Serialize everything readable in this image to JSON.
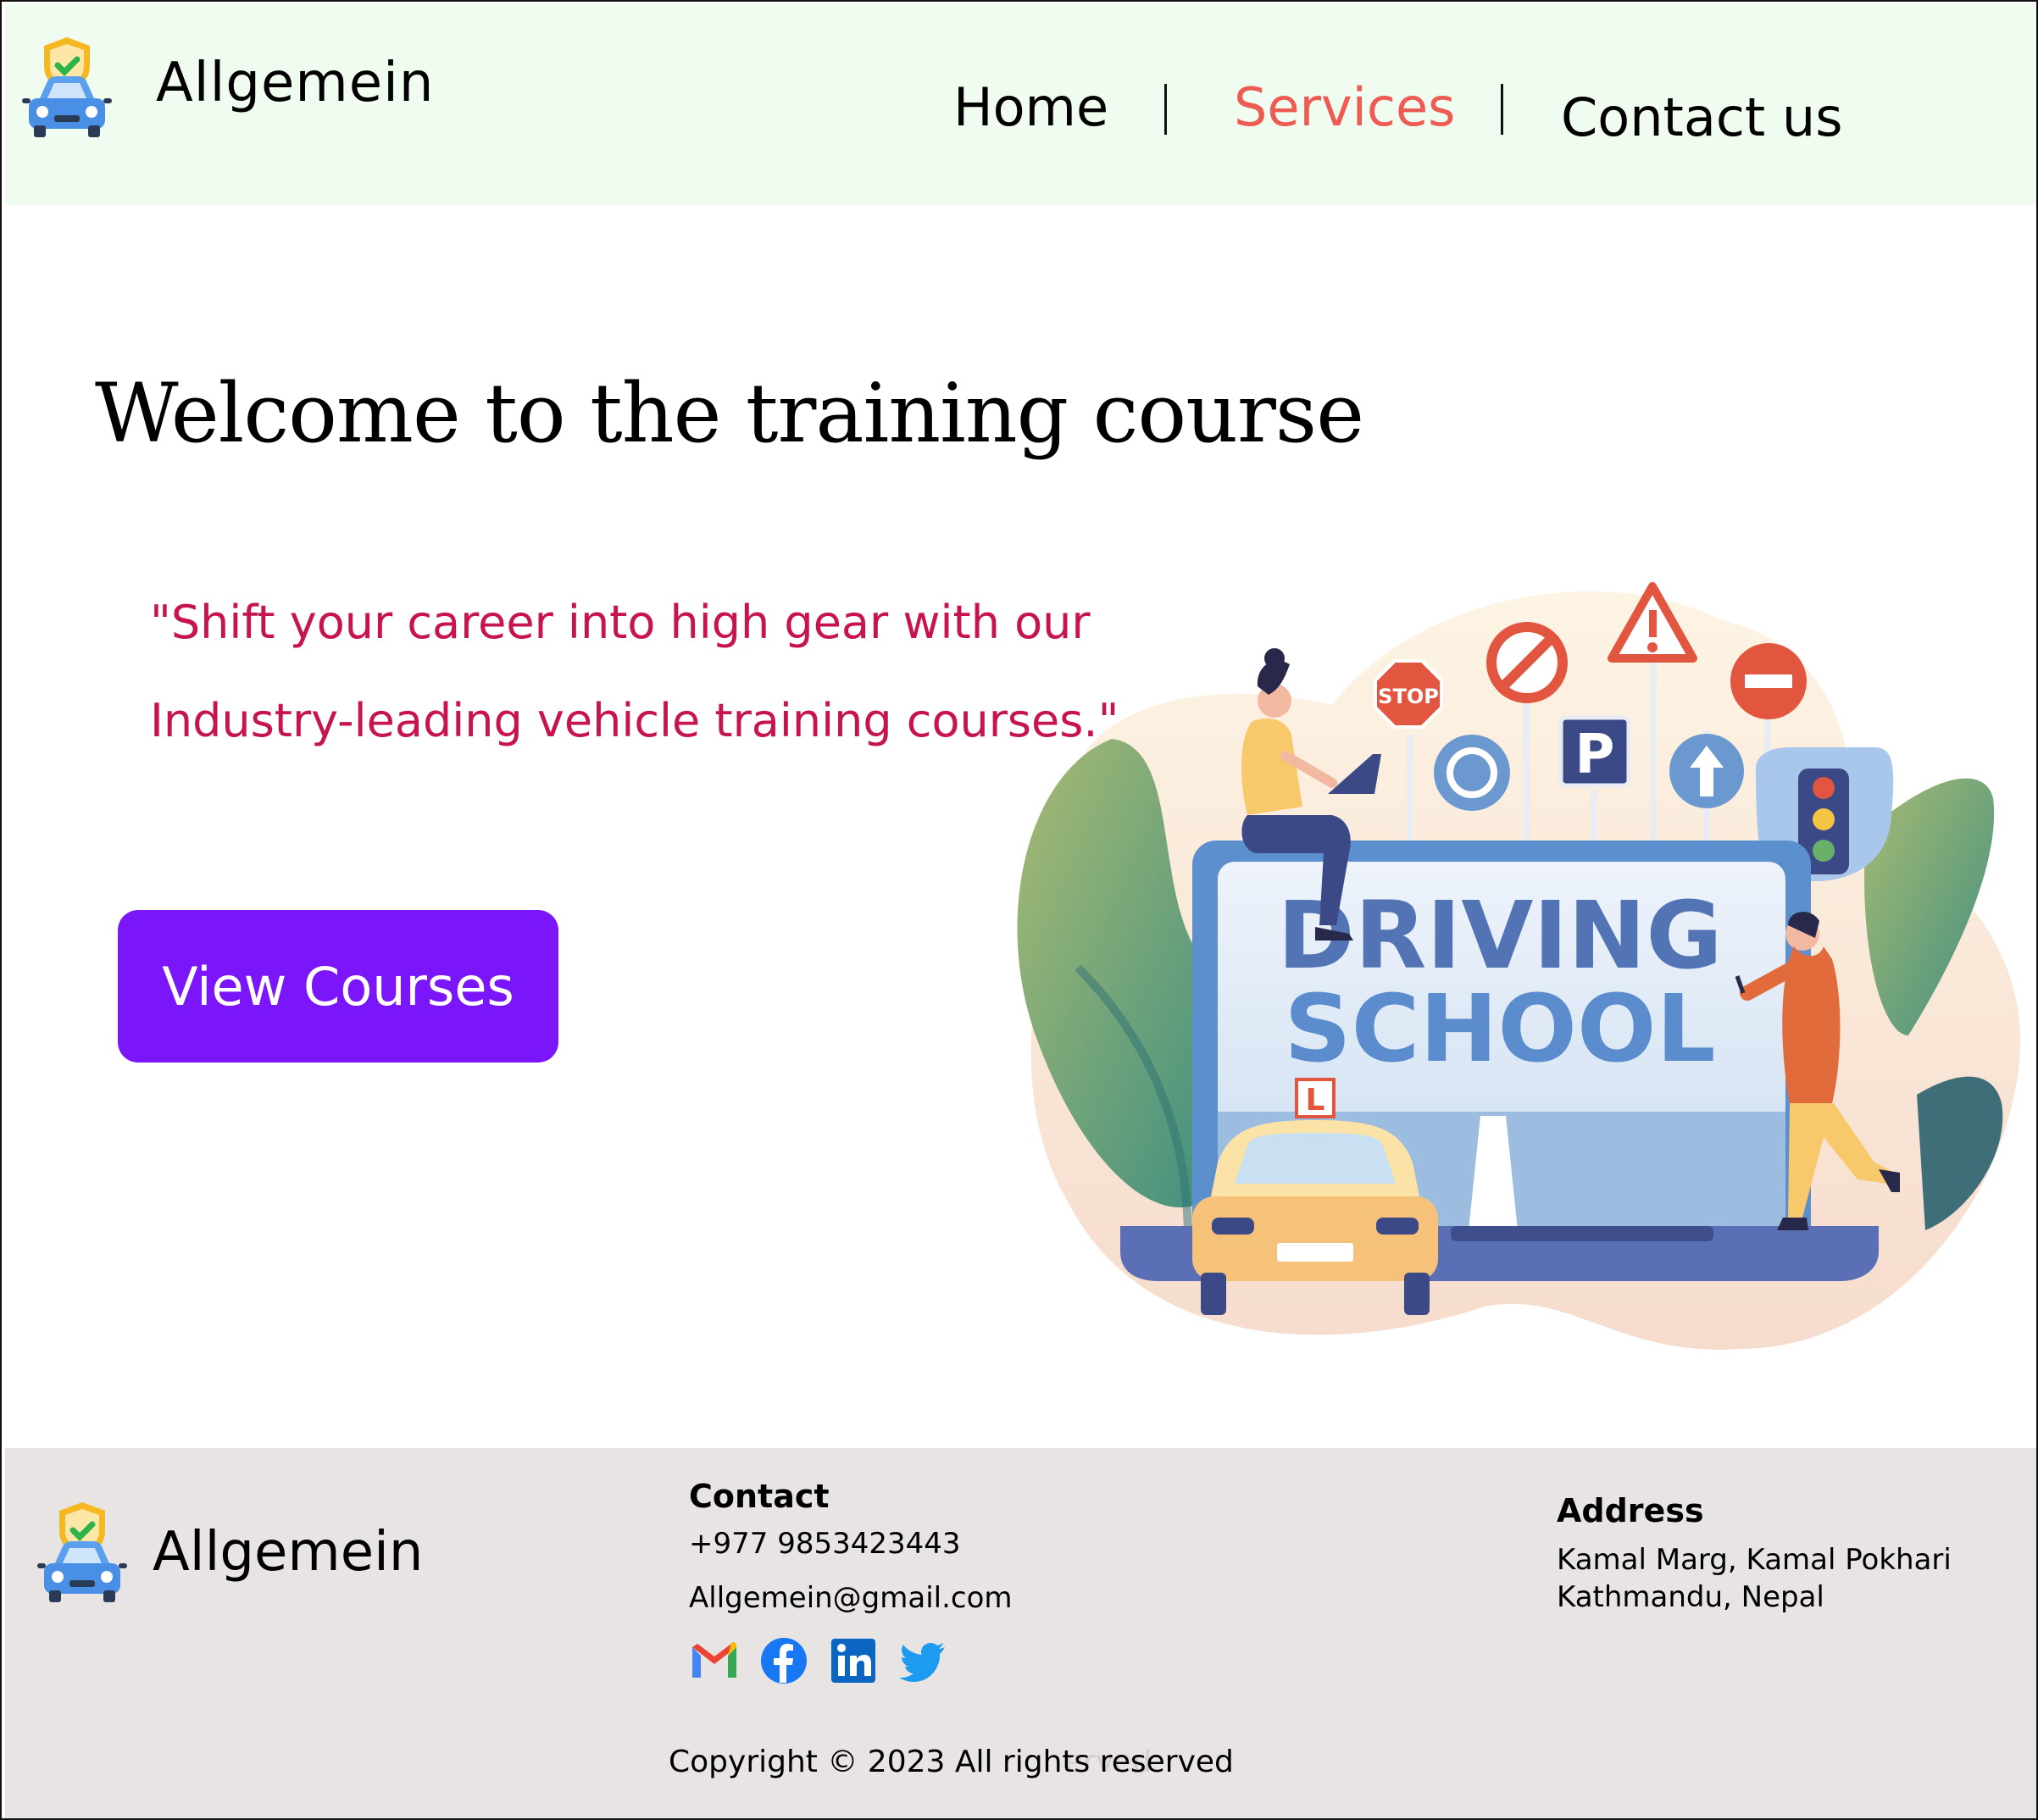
{
  "brand": {
    "name": "Allgemein"
  },
  "nav": {
    "home": "Home",
    "services": "Services",
    "contact": "Contact us",
    "separator": "|"
  },
  "hero": {
    "title": "Welcome to the training course",
    "quote_line1": "\"Shift your career into high gear with our",
    "quote_line2": "Industry-leading vehicle training courses.\"",
    "cta": "View Courses"
  },
  "illustration": {
    "line1": "DRIVING",
    "line2": "SCHOOL",
    "stop": "STOP",
    "parking": "P",
    "learner": "L"
  },
  "footer": {
    "brand": "Allgemein",
    "contact_heading": "Contact",
    "phone": "+977 9853423443",
    "email": "Allgemein@gmail.com",
    "address_heading": "Address",
    "address_line1": "Kamal Marg, Kamal Pokhari",
    "address_line2": "Kathmandu, Nepal",
    "social": [
      "gmail-icon",
      "facebook-icon",
      "linkedin-icon",
      "twitter-icon"
    ],
    "copyright": "Copyright © 2023 All rights reserved",
    "copyright_ghost": "erved"
  },
  "colors": {
    "header_bg": "#effcef",
    "active_nav": "#ee5b52",
    "quote": "#c7144e",
    "cta_bg": "#7b16fb",
    "footer_bg": "#e8e4e4"
  }
}
